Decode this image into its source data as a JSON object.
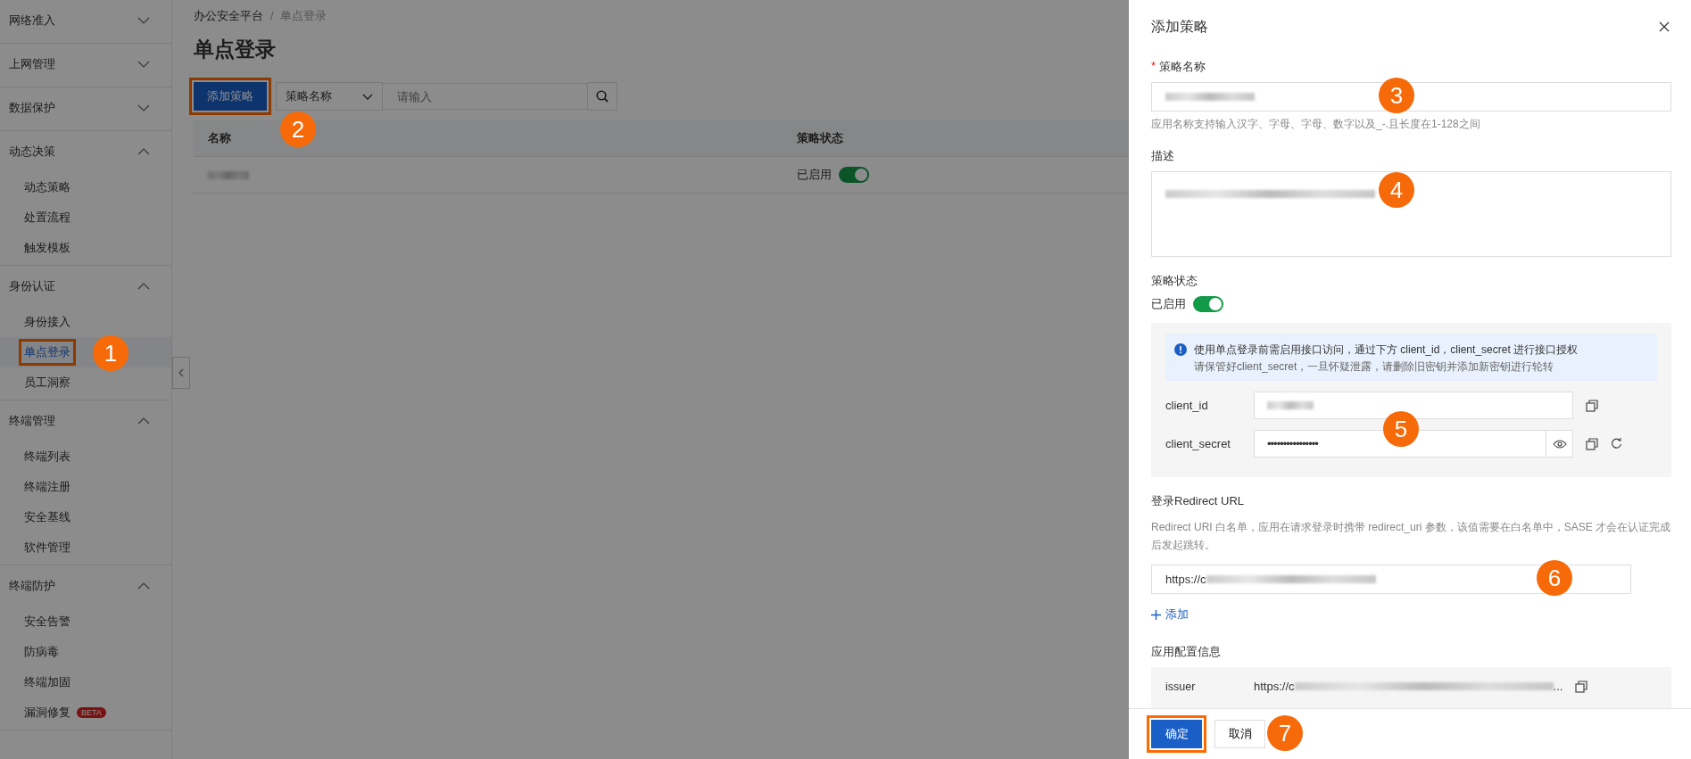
{
  "sidebar": {
    "groups": [
      {
        "label": "网络准入",
        "expanded": false
      },
      {
        "label": "上网管理",
        "expanded": false
      },
      {
        "label": "数据保护",
        "expanded": false
      },
      {
        "label": "动态决策",
        "expanded": true,
        "children": [
          {
            "label": "动态策略",
            "selected": false
          },
          {
            "label": "处置流程",
            "selected": false
          },
          {
            "label": "触发模板",
            "selected": false
          }
        ]
      },
      {
        "label": "身份认证",
        "expanded": true,
        "children": [
          {
            "label": "身份接入",
            "selected": false
          },
          {
            "label": "单点登录",
            "selected": true,
            "highlighted": true,
            "callout": "1"
          },
          {
            "label": "员工洞察",
            "selected": false
          }
        ]
      },
      {
        "label": "终端管理",
        "expanded": true,
        "children": [
          {
            "label": "终端列表",
            "selected": false
          },
          {
            "label": "终端注册",
            "selected": false
          },
          {
            "label": "安全基线",
            "selected": false
          },
          {
            "label": "软件管理",
            "selected": false
          }
        ]
      },
      {
        "label": "终端防护",
        "expanded": true,
        "children": [
          {
            "label": "安全告警",
            "selected": false
          },
          {
            "label": "防病毒",
            "selected": false
          },
          {
            "label": "终端加固",
            "selected": false
          },
          {
            "label": "漏洞修复",
            "selected": false,
            "badge": "BETA"
          }
        ]
      }
    ]
  },
  "breadcrumb": [
    "办公安全平台",
    "单点登录"
  ],
  "breadcrumb_separator": "/",
  "page_title": "单点登录",
  "toolbar": {
    "add_button": {
      "label": "添加策略",
      "highlighted": true,
      "callout": "2"
    },
    "filter_select": "策略名称",
    "search": {
      "placeholder": "请输入"
    }
  },
  "table": {
    "columns": [
      "名称",
      "策略状态"
    ],
    "rows": [
      {
        "name_redacted": true,
        "status": "已启用",
        "on": true
      }
    ]
  },
  "drawer": {
    "title": "添加策略",
    "name_field": {
      "label": "策略名称",
      "required_mark": "*",
      "redacted": true,
      "hint": "应用名称支持输入汉字、字母、字母、数字以及_-.且长度在1-128之间",
      "callout": "3"
    },
    "description_field": {
      "label": "描述",
      "redacted": true,
      "callout": "4"
    },
    "status_field": {
      "label": "策略状态",
      "text": "已启用",
      "on": true
    },
    "credentials": {
      "notice": "使用单点登录前需启用接口访问，通过下方 client_id，client_secret 进行接口授权",
      "notice_sub": "请保管好client_secret，一旦怀疑泄露，请删除旧密钥并添加新密钥进行轮转",
      "rows": [
        {
          "kind": "plain",
          "label": "client_id",
          "redacted": true
        },
        {
          "kind": "secret",
          "label": "client_secret",
          "value": "••••••••••••••••"
        }
      ],
      "callout": "5"
    },
    "redirect": {
      "label": "登录Redirect URL",
      "description": "Redirect URI 白名单，应用在请求登录时携带 redirect_uri 参数，该值需要在白名单中，SASE 才会在认证完成后发起跳转。",
      "urls": [
        {
          "value": "https://c",
          "redacted": true,
          "callout": "6"
        }
      ],
      "add_link": "添加"
    },
    "app_config": {
      "label": "应用配置信息",
      "rows": [
        {
          "key": "issuer",
          "value": "https://c",
          "suffix": "...",
          "redacted": true
        }
      ]
    },
    "footer": {
      "confirm": {
        "label": "确定",
        "highlighted": true,
        "callout": "7"
      },
      "cancel": "取消"
    }
  }
}
